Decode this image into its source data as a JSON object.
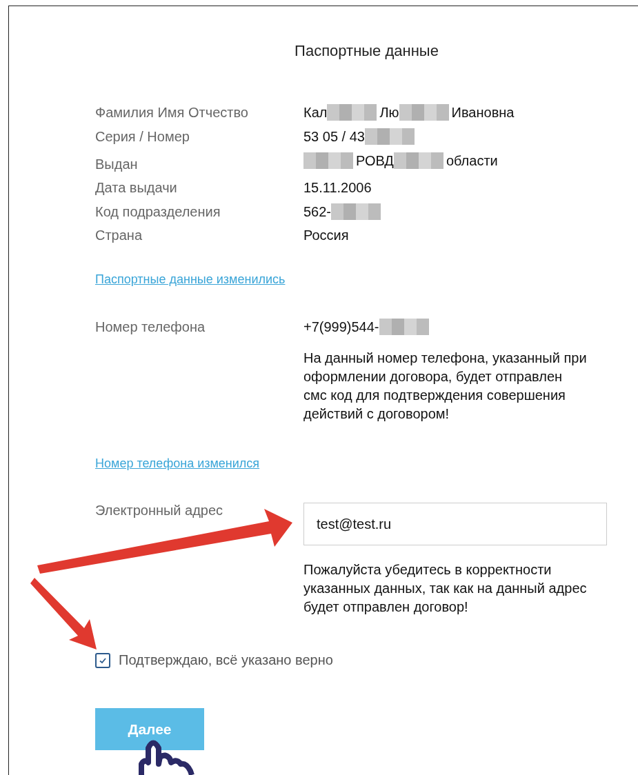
{
  "title": "Паспортные данные",
  "passport": [
    {
      "label": "Фамилия Имя Отчество",
      "value": [
        {
          "kind": "text",
          "text": "Кал"
        },
        {
          "kind": "redacted"
        },
        {
          "kind": "text",
          "text": "Лю"
        },
        {
          "kind": "redacted"
        },
        {
          "kind": "text",
          "text": "Ивановна"
        }
      ]
    },
    {
      "label": "Серия / Номер",
      "value": [
        {
          "kind": "text",
          "text": "53 05 / 43"
        },
        {
          "kind": "redacted"
        }
      ]
    },
    {
      "label": "Выдан",
      "value": [
        {
          "kind": "redacted"
        },
        {
          "kind": "text",
          "text": "РОВД"
        },
        {
          "kind": "redacted"
        },
        {
          "kind": "text",
          "text": "области"
        }
      ]
    },
    {
      "label": "Дата выдачи",
      "value": [
        {
          "kind": "text",
          "text": "15.11.2006"
        }
      ]
    },
    {
      "label": "Код подразделения",
      "value": [
        {
          "kind": "text",
          "text": "562-"
        },
        {
          "kind": "redacted"
        }
      ]
    },
    {
      "label": "Страна",
      "value": [
        {
          "kind": "text",
          "text": "Россия"
        }
      ]
    }
  ],
  "passport_link": "Паспортные данные изменились",
  "phone": {
    "label": "Номер телефона",
    "value": [
      {
        "kind": "text",
        "text": "+7(999)544-"
      },
      {
        "kind": "redacted"
      }
    ],
    "note": "На данный номер телефона, указанный при оформлении договора, будет отправлен смс код для подтверждения совершения действий с договором!"
  },
  "phone_link": "Номер телефона изменился",
  "email": {
    "label": "Электронный адрес",
    "value": "test@test.ru",
    "note": "Пожалуйста убедитесь в корректности указанных данных, так как на данный адрес будет отправлен договор!"
  },
  "confirm": {
    "label": "Подтверждаю, всё указано верно",
    "checked": true
  },
  "next_button": "Далее"
}
